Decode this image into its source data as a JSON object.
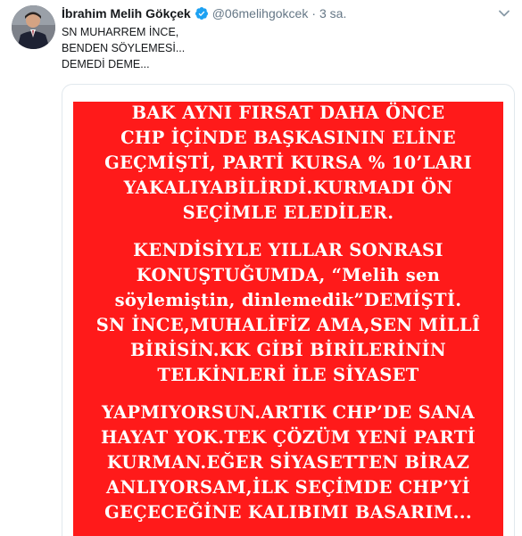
{
  "tweet": {
    "author_name": "İbrahim Melih Gökçek",
    "handle": "@06melihgokcek",
    "separator": "·",
    "time": "3 sa.",
    "text_lines": [
      "SN MUHARREM İNCE,",
      "BENDEN SÖYLEMESİ...",
      "DEMEDİ DEME..."
    ]
  },
  "poster": {
    "background_color": "#ff1a1a",
    "text_color": "#ffffff",
    "lines": [
      "BAK AYNI FIRSAT DAHA ÖNCE",
      "CHP İÇİNDE BAŞKASININ ELİNE",
      "GEÇMİŞTİ, PARTİ KURSA % 10’LARI",
      "YAKALIYABİLİRDİ.KURMADI ÖN",
      "SEÇİMLE ELEDİLER.",
      "KENDİSİYLE YILLAR SONRASI",
      "KONUŞTUĞUMDA, “Melih sen",
      "söylemiştin, dinlemedik”DEMİŞTİ.",
      "SN İNCE,MUHALİFİZ AMA,SEN MİLLÎ",
      "BİRİSİN.KK GİBİ BİRİLERİNİN",
      "TELKİNLERİ İLE SİYASET",
      "YAPMIYORSUN.ARTIK CHP’DE SANA",
      "HAYAT YOK.TEK ÇÖZÜM YENİ PARTİ",
      "KURMAN.EĞER SİYASETTEN BİRAZ",
      "ANLIYORSAM,İLK SEÇİMDE CHP’Yİ",
      "GEÇECEĞİNE KALIBIMI BASARIM..."
    ]
  },
  "icons": {
    "verified": "verified-badge-icon",
    "caret": "chevron-down-icon"
  },
  "colors": {
    "verified_blue": "#1da1f2",
    "text_primary": "#14171a",
    "text_secondary": "#657786"
  }
}
